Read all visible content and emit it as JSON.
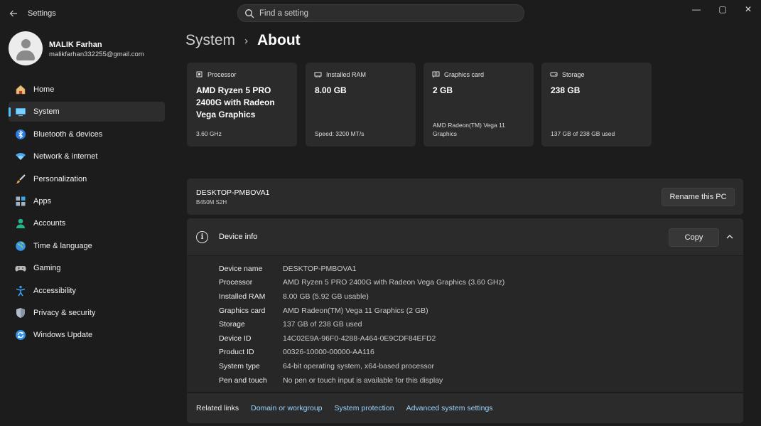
{
  "window": {
    "title": "Settings",
    "search_placeholder": "Find a setting",
    "minimize": "—",
    "maximize": "▢",
    "close": "✕"
  },
  "profile": {
    "name": "MALIK Farhan",
    "email": "malikfarhan332255@gmail.com"
  },
  "sidebar": {
    "items": [
      {
        "label": "Home",
        "icon": "home-icon",
        "active": false
      },
      {
        "label": "System",
        "icon": "system-icon",
        "active": true
      },
      {
        "label": "Bluetooth & devices",
        "icon": "bluetooth-icon",
        "active": false
      },
      {
        "label": "Network & internet",
        "icon": "wifi-icon",
        "active": false
      },
      {
        "label": "Personalization",
        "icon": "brush-icon",
        "active": false
      },
      {
        "label": "Apps",
        "icon": "apps-icon",
        "active": false
      },
      {
        "label": "Accounts",
        "icon": "accounts-icon",
        "active": false
      },
      {
        "label": "Time & language",
        "icon": "globe-icon",
        "active": false
      },
      {
        "label": "Gaming",
        "icon": "gamepad-icon",
        "active": false
      },
      {
        "label": "Accessibility",
        "icon": "accessibility-icon",
        "active": false
      },
      {
        "label": "Privacy & security",
        "icon": "shield-icon",
        "active": false
      },
      {
        "label": "Windows Update",
        "icon": "update-icon",
        "active": false
      }
    ]
  },
  "breadcrumb": {
    "parent": "System",
    "separator": "›",
    "current": "About"
  },
  "cards": [
    {
      "label": "Processor",
      "value": "AMD Ryzen 5 PRO 2400G with Radeon Vega Graphics",
      "sub": "3.60 GHz",
      "icon": "processor-icon"
    },
    {
      "label": "Installed RAM",
      "value": "8.00 GB",
      "sub": "Speed: 3200 MT/s",
      "icon": "ram-icon"
    },
    {
      "label": "Graphics card",
      "value": "2 GB",
      "sub": "AMD Radeon(TM) Vega 11 Graphics",
      "icon": "graphics-card-icon"
    },
    {
      "label": "Storage",
      "value": "238 GB",
      "sub": "137 GB of 238 GB used",
      "icon": "storage-icon"
    }
  ],
  "pc": {
    "name": "DESKTOP-PMBOVA1",
    "model": "B450M S2H",
    "rename_label": "Rename this PC"
  },
  "device_info": {
    "title": "Device info",
    "copy_label": "Copy",
    "rows": [
      {
        "key": "Device name",
        "value": "DESKTOP-PMBOVA1"
      },
      {
        "key": "Processor",
        "value": "AMD Ryzen 5 PRO 2400G with Radeon Vega Graphics (3.60 GHz)"
      },
      {
        "key": "Installed RAM",
        "value": "8.00 GB (5.92 GB usable)"
      },
      {
        "key": "Graphics card",
        "value": "AMD Radeon(TM) Vega 11 Graphics (2 GB)"
      },
      {
        "key": "Storage",
        "value": "137 GB of 238 GB used"
      },
      {
        "key": "Device ID",
        "value": "14C02E9A-96F0-4288-A464-0E9CDF84EFD2"
      },
      {
        "key": "Product ID",
        "value": "00326-10000-00000-AA116"
      },
      {
        "key": "System type",
        "value": "64-bit operating system, x64-based processor"
      },
      {
        "key": "Pen and touch",
        "value": "No pen or touch input is available for this display"
      }
    ]
  },
  "related_links": {
    "label": "Related links",
    "links": [
      "Domain or workgroup",
      "System protection",
      "Advanced system settings"
    ]
  },
  "colors": {
    "accent": "#4cc2ff",
    "link": "#99d4ff",
    "background": "#1c1c1c",
    "card": "#2b2b2b"
  }
}
